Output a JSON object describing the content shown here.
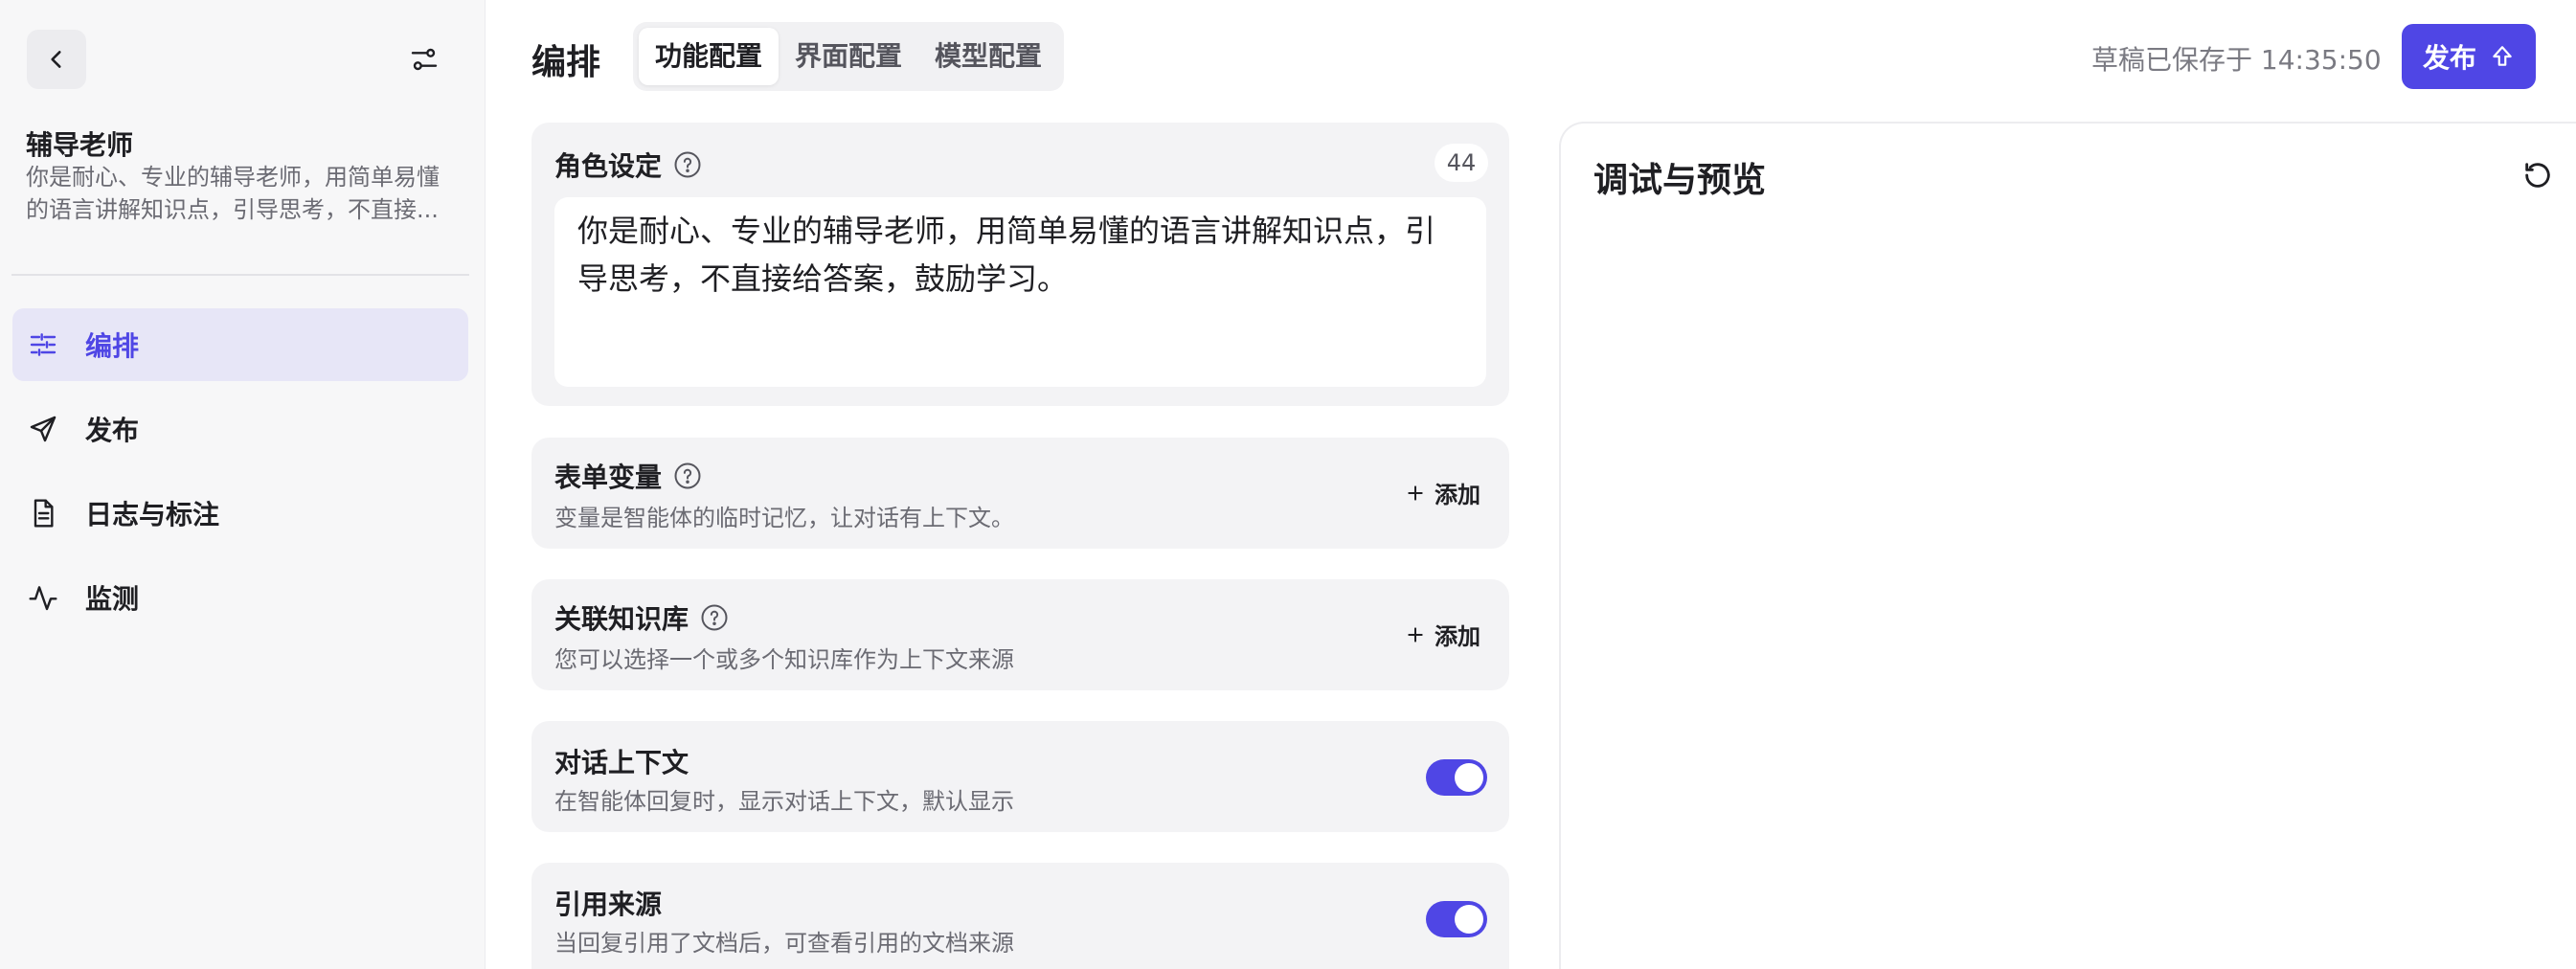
{
  "sidebar": {
    "agent": {
      "name": "辅导老师",
      "description": "你是耐心、专业的辅导老师，用简单易懂的语言讲解知识点，引导思考，不直接..."
    },
    "nav": [
      {
        "label": "编排",
        "icon": "sliders-icon",
        "active": true
      },
      {
        "label": "发布",
        "icon": "send-icon",
        "active": false
      },
      {
        "label": "日志与标注",
        "icon": "document-icon",
        "active": false
      },
      {
        "label": "监测",
        "icon": "activity-icon",
        "active": false
      }
    ]
  },
  "header": {
    "title": "编排",
    "tabs": [
      {
        "label": "功能配置",
        "active": true
      },
      {
        "label": "界面配置",
        "active": false
      },
      {
        "label": "模型配置",
        "active": false
      }
    ],
    "save_status": "草稿已保存于 14:35:50",
    "publish_label": "发布"
  },
  "config": {
    "role": {
      "title": "角色设定",
      "char_count": "44",
      "prompt": "你是耐心、专业的辅导老师，用简单易懂的语言讲解知识点，引导思考，不直接给答案，鼓励学习。"
    },
    "form_vars": {
      "title": "表单变量",
      "subtitle": "变量是智能体的临时记忆，让对话有上下文。",
      "add_label": "添加"
    },
    "knowledge": {
      "title": "关联知识库",
      "subtitle": "您可以选择一个或多个知识库作为上下文来源",
      "add_label": "添加"
    },
    "context": {
      "title": "对话上下文",
      "subtitle": "在智能体回复时，显示对话上下文，默认显示",
      "enabled": true
    },
    "citation": {
      "title": "引用来源",
      "subtitle": "当回复引用了文档后，可查看引用的文档来源",
      "enabled": true
    }
  },
  "preview": {
    "title": "调试与预览"
  },
  "colors": {
    "accent": "#4f46e5",
    "sidebar_bg": "#f7f7f8",
    "panel_bg": "#f3f3f5",
    "active_nav_bg": "#e7e6f7"
  }
}
